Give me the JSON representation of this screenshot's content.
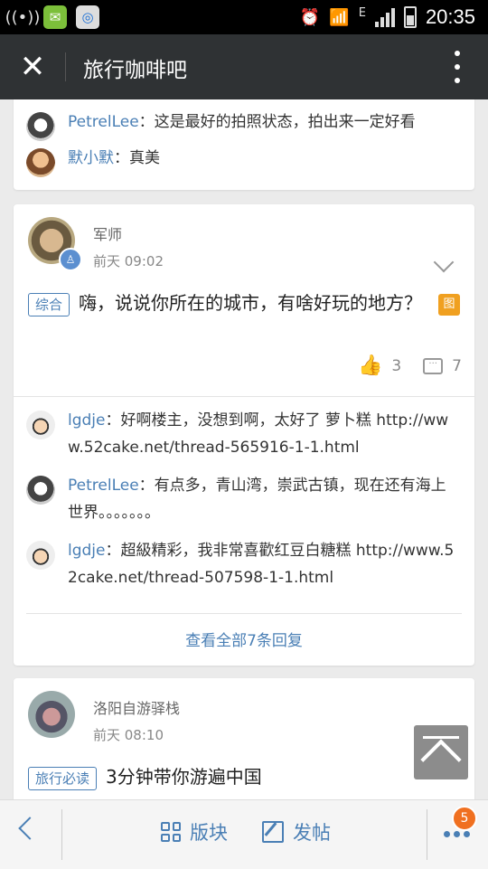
{
  "status_bar": {
    "time": "20:35",
    "network": "E"
  },
  "title_bar": {
    "title": "旅行咖啡吧"
  },
  "card1": {
    "replies": [
      {
        "user": "PetrelLee",
        "text": "：这是最好的拍照状态，拍出来一定好看"
      },
      {
        "user": "默小默",
        "text": "：真美"
      }
    ]
  },
  "post1": {
    "author": "军师",
    "time": "前天 09:02",
    "tag": "综合",
    "title": "嗨，说说你所在的城市，有啥好玩的地方？",
    "image_badge": "图",
    "likes": "3",
    "comments": "7",
    "replies": [
      {
        "user": "lgdje",
        "text": "：好啊楼主，没想到啊，太好了 萝卜糕 http://www.52cake.net/thread-565916-1-1.html"
      },
      {
        "user": "PetrelLee",
        "text": "：有点多，青山湾，崇武古镇，现在还有海上世界。。。。。。。"
      },
      {
        "user": "lgdje",
        "text": "：超級精彩，我非常喜歡红豆白糖糕 http://www.52cake.net/thread-507598-1-1.html"
      }
    ],
    "view_all": "查看全部7条回复"
  },
  "post2": {
    "author": "洛阳自游驿栈",
    "time": "前天 08:10",
    "tag": "旅行必读",
    "title": "3分钟带你游遍中国"
  },
  "bottom_bar": {
    "sections_label": "版块",
    "post_label": "发帖",
    "notification_count": "5"
  }
}
